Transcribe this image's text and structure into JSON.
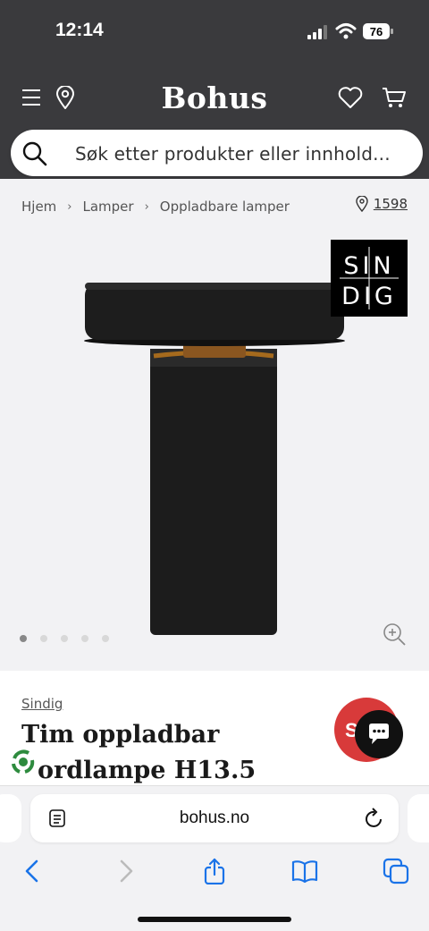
{
  "status_bar": {
    "time": "12:14",
    "battery": "76"
  },
  "header": {
    "logo": "Bohus",
    "icons": [
      "menu-icon",
      "location-pin-icon",
      "heart-icon",
      "cart-icon"
    ],
    "background": "#3a3a3d"
  },
  "search": {
    "placeholder": "Søk etter produkter eller innhold..."
  },
  "breadcrumb": {
    "items": [
      "Hjem",
      "Lamper",
      "Oppladbare lamper"
    ],
    "store_number": "1598"
  },
  "gallery": {
    "brand_logo_lines": [
      "SIN",
      "DIG"
    ],
    "dot_count": 5,
    "active_dot": 0
  },
  "product": {
    "brand": "Sindig",
    "title": "Tim oppladbar bordlampe H13.5",
    "title_visible_line1": "Tim oppladbar",
    "title_visible_line2": "ordlampe H13.5",
    "sale_badge": "S",
    "sale_color": "#d83a3a"
  },
  "browser": {
    "url": "bohus.no",
    "nav_icons": [
      "back-icon",
      "forward-icon",
      "share-icon",
      "bookmarks-icon",
      "tabs-icon"
    ],
    "accent": "#1a73e8"
  }
}
